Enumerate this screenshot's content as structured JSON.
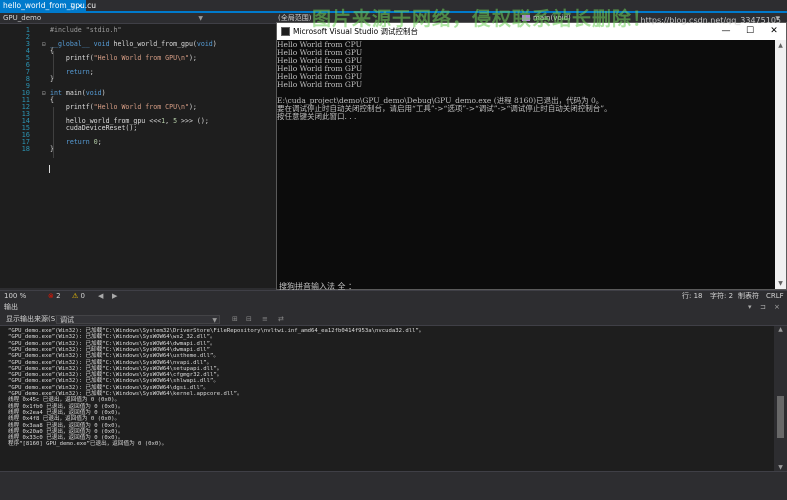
{
  "tab": {
    "label": "hello_world_from_gpu.cu",
    "pin": "⊐",
    "close": "×"
  },
  "nav": {
    "project": "GPU_demo",
    "scope": "(全局范围)",
    "member": "main(void)"
  },
  "editor": {
    "lines": [
      {
        "n": "1",
        "html": "<span class='pp'>#include \"stdio.h\"</span>"
      },
      {
        "n": "2",
        "html": ""
      },
      {
        "n": "3",
        "fold": "⊟",
        "html": "<span class='kw'>__global__ void</span> hello_world_from_gpu(<span class='kw'>void</span>)"
      },
      {
        "n": "4",
        "html": "{"
      },
      {
        "n": "5",
        "html": "    printf(<span class='str'>\"Hello World from GPU\\n\"</span>);"
      },
      {
        "n": "6",
        "html": ""
      },
      {
        "n": "7",
        "html": "    <span class='kw'>return</span>;"
      },
      {
        "n": "8",
        "html": "}"
      },
      {
        "n": "9",
        "html": ""
      },
      {
        "n": "10",
        "fold": "⊟",
        "html": "<span class='kw'>int</span> main(<span class='kw'>void</span>)"
      },
      {
        "n": "11",
        "html": "{"
      },
      {
        "n": "12",
        "html": "    printf(<span class='str'>\"Hello World from CPU\\n\"</span>);"
      },
      {
        "n": "13",
        "html": ""
      },
      {
        "n": "14",
        "html": "    hello_world_from_gpu &lt;&lt;&lt;<span class='num'>1</span>, <span class='num'>5</span> &gt;&gt;&gt; ();"
      },
      {
        "n": "15",
        "html": "    cudaDeviceReset();"
      },
      {
        "n": "16",
        "html": ""
      },
      {
        "n": "17",
        "html": "    <span class='kw'>return</span> <span class='num'>0</span>;"
      },
      {
        "n": "18",
        "html": "}"
      }
    ]
  },
  "console": {
    "title": "Microsoft Visual Studio 调试控制台",
    "minimize": "—",
    "maximize": "☐",
    "close": "✕",
    "lines": [
      "Hello World from CPU",
      "Hello World from GPU",
      "Hello World from GPU",
      "Hello World from GPU",
      "Hello World from GPU",
      "Hello World from GPU",
      "",
      "E:\\cuda_project\\demo\\GPU_demo\\Debug\\GPU_demo.exe (进程 8160)已退出，代码为 0。",
      "要在调试停止时自动关闭控制台，请启用“工具”->“选项”->“调试”->“调试停止时自动关闭控制台”。",
      "按任意键关闭此窗口. . ."
    ],
    "ime": "搜狗拼音输入法 全 ："
  },
  "watermark": "图片来源于网络，侵权联系站长删除！",
  "editor_status": {
    "zoom": "100 %",
    "errors": "2",
    "warnings": "0",
    "row": "行: 18",
    "col": "字符: 2",
    "ins": "制表符",
    "eol": "CRLF"
  },
  "output": {
    "header": "输出",
    "source_label": "显示输出来源(S):",
    "source_value": "调试",
    "lines": [
      "“GPU_demo.exe”(Win32): 已加载“C:\\Windows\\System32\\DriverStore\\FileRepository\\nvltwi.inf_amd64_ea12fb0414f953a\\nvcuda32.dll”。",
      "“GPU_demo.exe”(Win32): 已加载“C:\\Windows\\SysWOW64\\ws2_32.dll”。",
      "“GPU_demo.exe”(Win32): 已加载“C:\\Windows\\SysWOW64\\dwmapi.dll”。",
      "“GPU_demo.exe”(Win32): 已卸载“C:\\Windows\\SysWOW64\\dwmapi.dll”",
      "“GPU_demo.exe”(Win32): 已加载“C:\\Windows\\SysWOW64\\uxtheme.dll”。",
      "“GPU_demo.exe”(Win32): 已加载“C:\\Windows\\SysWOW64\\nvapi.dll”。",
      "“GPU_demo.exe”(Win32): 已加载“C:\\Windows\\SysWOW64\\setupapi.dll”。",
      "“GPU_demo.exe”(Win32): 已加载“C:\\Windows\\SysWOW64\\cfgmgr32.dll”。",
      "“GPU_demo.exe”(Win32): 已加载“C:\\Windows\\SysWOW64\\shlwapi.dll”。",
      "“GPU_demo.exe”(Win32): 已加载“C:\\Windows\\SysWOW64\\dgsi.dll”。",
      "“GPU_demo.exe”(Win32): 已加载“C:\\Windows\\SysWOW64\\kernel.appcore.dll”。",
      "线程 0x45c 已退出，返回值为 0 (0x0)。",
      "线程 0x1fb0 已退出，返回值为 0 (0x0)。",
      "线程 0x2ea4 已退出，返回值为 0 (0x0)。",
      "线程 0x4f8 已退出，返回值为 0 (0x0)。",
      "线程 0x3aa8 已退出，返回值为 0 (0x0)。",
      "线程 0x20a0 已退出，返回值为 0 (0x0)。",
      "线程 0x33c0 已退出，返回值为 0 (0x0)。",
      "程序“[8160] GPU_demo.exe”已退出，返回值为 0 (0x0)。"
    ]
  },
  "credit": "https://blog.csdn.net/qq_33475105"
}
